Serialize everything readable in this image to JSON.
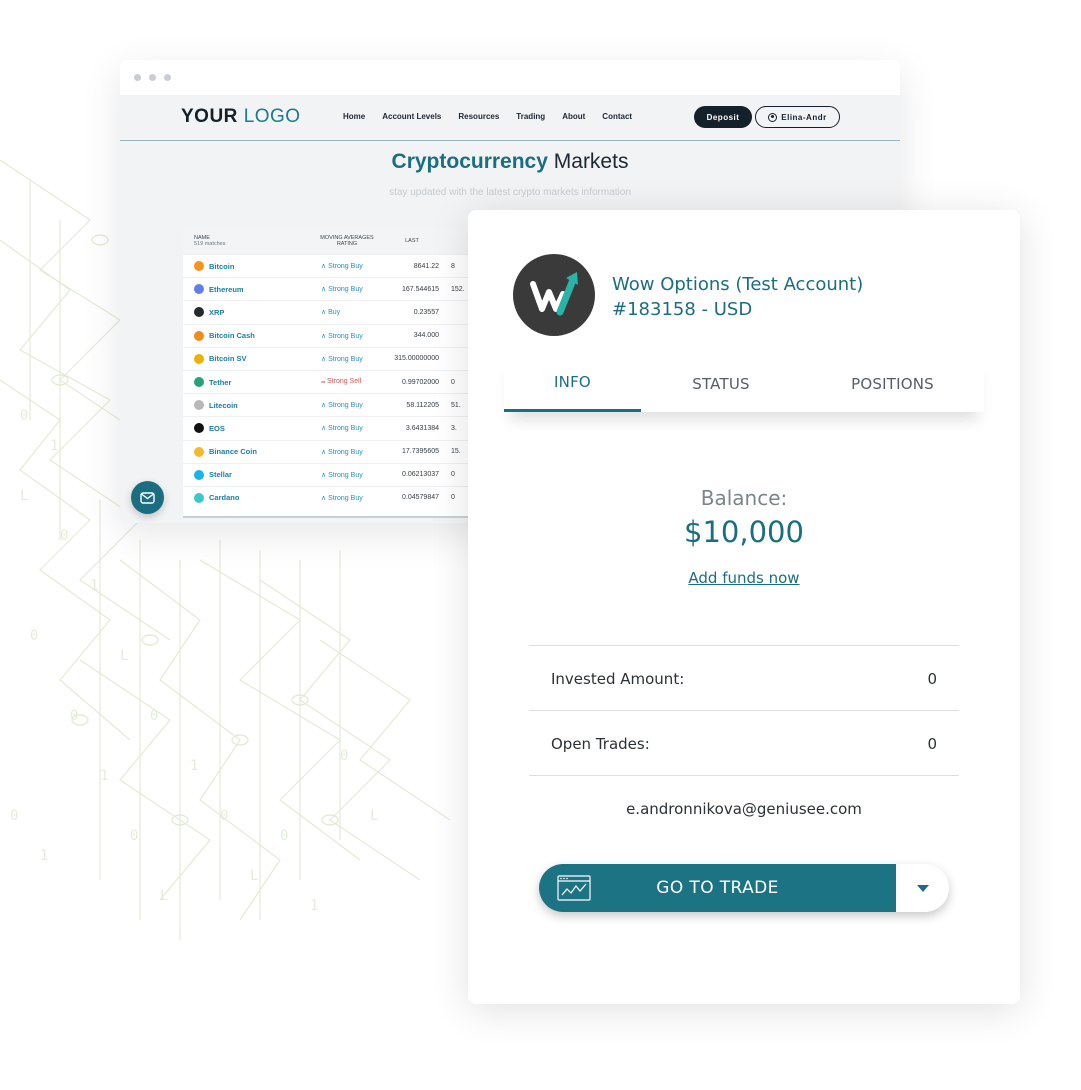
{
  "browser": {
    "logo_bold": "YOUR",
    "logo_light": "LOGO",
    "nav": [
      "Home",
      "Account Levels",
      "Resources",
      "Trading",
      "About",
      "Contact"
    ],
    "deposit_label": "Deposit",
    "user_label": "Elina-Andr",
    "hero_title_bold": "Cryptocurrency",
    "hero_title_rest": "Markets",
    "hero_subtitle": "stay updated with the latest crypto markets information",
    "table": {
      "col_name": "NAME",
      "matches": "519 matches",
      "col_rating": "MOVING AVERAGES RATING",
      "col_last": "LAST",
      "rows": [
        {
          "name": "Bitcoin",
          "rating": "Strong Buy",
          "last": "8641.22",
          "extra": "8",
          "color": "#f7931a",
          "sell": false
        },
        {
          "name": "Ethereum",
          "rating": "Strong Buy",
          "last": "167.544615",
          "extra": "152.",
          "color": "#627eea",
          "sell": false
        },
        {
          "name": "XRP",
          "rating": "Buy",
          "last": "0.23557",
          "extra": "",
          "color": "#23292f",
          "sell": false
        },
        {
          "name": "Bitcoin Cash",
          "rating": "Strong Buy",
          "last": "344.000",
          "extra": "",
          "color": "#f08c1a",
          "sell": false
        },
        {
          "name": "Bitcoin SV",
          "rating": "Strong Buy",
          "last": "315.00000000",
          "extra": "",
          "color": "#eab300",
          "sell": false
        },
        {
          "name": "Tether",
          "rating": "Strong Sell",
          "last": "0.99702000",
          "extra": "0",
          "color": "#26a17b",
          "sell": true
        },
        {
          "name": "Litecoin",
          "rating": "Strong Buy",
          "last": "58.112205",
          "extra": "51.",
          "color": "#b8b8b8",
          "sell": false
        },
        {
          "name": "EOS",
          "rating": "Strong Buy",
          "last": "3.6431384",
          "extra": "3.",
          "color": "#111111",
          "sell": false
        },
        {
          "name": "Binance Coin",
          "rating": "Strong Buy",
          "last": "17.7395605",
          "extra": "15.",
          "color": "#f3ba2f",
          "sell": false
        },
        {
          "name": "Stellar",
          "rating": "Strong Buy",
          "last": "0.06213037",
          "extra": "0",
          "color": "#14b6e7",
          "sell": false
        },
        {
          "name": "Cardano",
          "rating": "Strong Buy",
          "last": "0.04579847",
          "extra": "0",
          "color": "#3cc8c8",
          "sell": false
        }
      ]
    }
  },
  "card": {
    "account_name": "Wow Options (Test Account)",
    "account_id": "#183158 - USD",
    "tabs": [
      "INFO",
      "STATUS",
      "POSITIONS"
    ],
    "balance_label": "Balance:",
    "balance_value": "$10,000",
    "add_funds": "Add funds now",
    "invested_label": "Invested Amount:",
    "invested_value": "0",
    "open_trades_label": "Open Trades:",
    "open_trades_value": "0",
    "email": "e.andronnikova@geniusee.com",
    "trade_button": "GO TO TRADE"
  },
  "colors": {
    "accent": "#1b6e80",
    "dark": "#14212b"
  }
}
